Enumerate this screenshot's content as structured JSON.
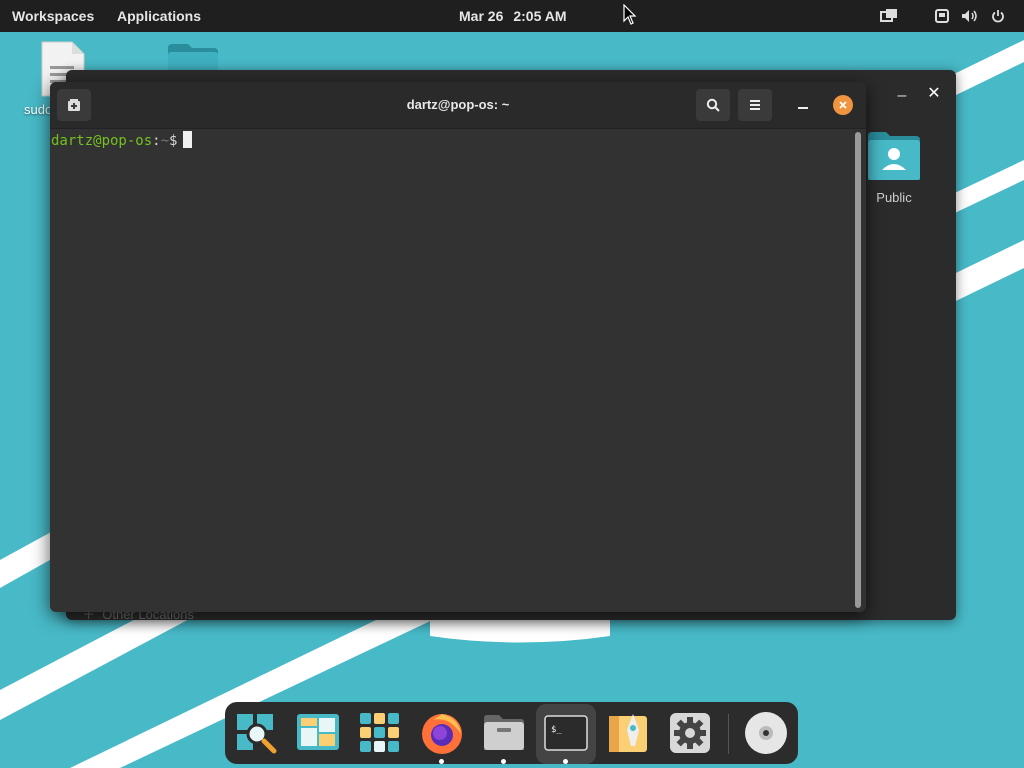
{
  "topbar": {
    "workspaces": "Workspaces",
    "applications": "Applications",
    "date": "Mar 26",
    "time": "2:05 AM",
    "tray_icons": [
      "window-switcher-icon",
      "network-icon",
      "volume-icon",
      "power-icon"
    ]
  },
  "desktop": {
    "file_label": "sudo",
    "accent": "#48b9c7"
  },
  "files_window": {
    "public_label": "Public",
    "other_locations": "Other Locations"
  },
  "terminal": {
    "title": "dartz@pop-os: ~",
    "prompt_user": "dartz@pop-os",
    "prompt_sep": ":",
    "prompt_path": "~",
    "prompt_symbol": "$",
    "close_color": "#f0943f"
  },
  "dock": {
    "items": [
      {
        "name": "search-app-icon",
        "running": false
      },
      {
        "name": "workspaces-icon",
        "running": false
      },
      {
        "name": "app-grid-icon",
        "running": false
      },
      {
        "name": "firefox-icon",
        "running": true
      },
      {
        "name": "files-icon",
        "running": true
      },
      {
        "name": "terminal-icon",
        "running": true
      },
      {
        "name": "pop-shop-icon",
        "running": false
      },
      {
        "name": "settings-icon",
        "running": false
      },
      {
        "name": "disc-icon",
        "running": false
      }
    ]
  }
}
